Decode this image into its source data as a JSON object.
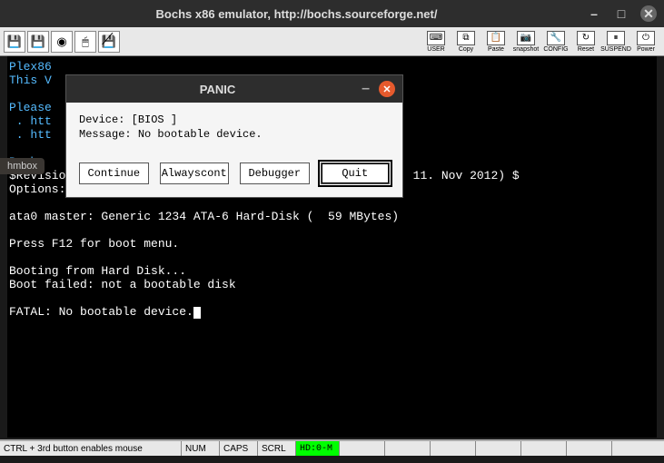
{
  "window": {
    "title": "Bochs x86 emulator, http://bochs.sourceforge.net/"
  },
  "toolbar": {
    "left_icons": [
      "floppy",
      "floppy2",
      "cdrom",
      "mouse",
      "no-floppy"
    ],
    "right": {
      "user": "USER",
      "copy": "Copy",
      "paste": "Paste",
      "snapshot": "snapshot",
      "config": "CONFIG",
      "reset": "Reset",
      "suspend": "SUSPEND",
      "power": "Power"
    }
  },
  "console": {
    "l1": "Plex86",
    "l2": "This V",
    "l3": "",
    "l4": "Please",
    "l5": " . htt",
    "l6": " . htt",
    "l7": "",
    "l8": "Bochs ",
    "l9": "$Revision: 11545 $ $Date: 2012-11-11 09:11:17 +0100 (So, 11. Nov 2012) $",
    "l10": "Options: apmbios pcibios pnpbios eltorito rombios32",
    "l11": "",
    "l12": "ata0 master: Generic 1234 ATA-6 Hard-Disk (  59 MBytes)",
    "l13": "",
    "l14": "Press F12 for boot menu.",
    "l15": "",
    "l16": "Booting from Hard Disk...",
    "l17": "Boot failed: not a bootable disk",
    "l18": "",
    "l19": "FATAL: No bootable device."
  },
  "side_tab": "hmbox",
  "dialog": {
    "title": "PANIC",
    "device_label": "Device:",
    "device_value": "[BIOS ]",
    "message_label": "Message:",
    "message_value": "No bootable device.",
    "buttons": {
      "continue": "Continue",
      "alwayscont": "Alwayscont",
      "debugger": "Debugger",
      "quit": "Quit"
    }
  },
  "statusbar": {
    "mouse": "CTRL + 3rd button enables mouse",
    "num": "NUM",
    "caps": "CAPS",
    "scrl": "SCRL",
    "hd": "HD:0-M"
  }
}
